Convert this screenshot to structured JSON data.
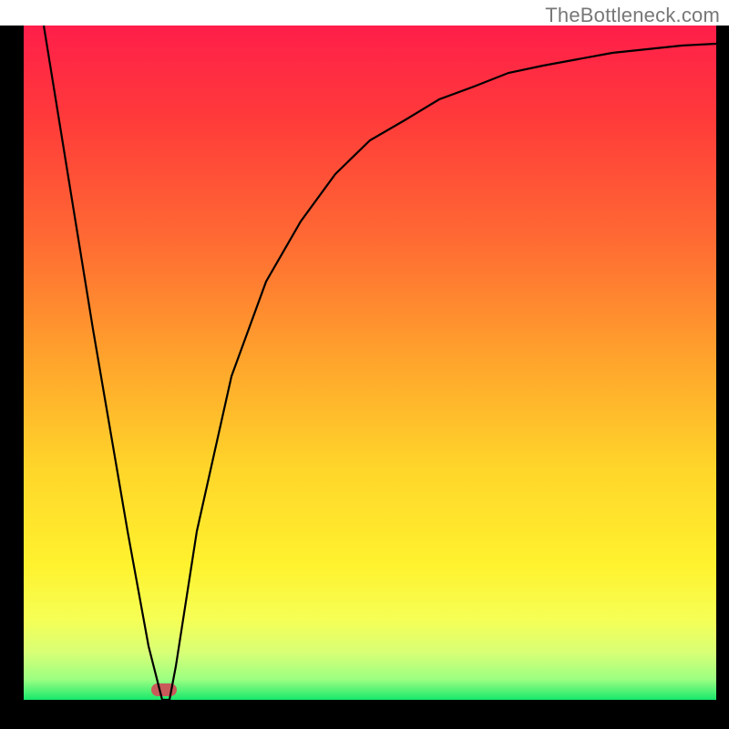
{
  "watermark": "TheBottleneck.com",
  "chart_data": {
    "type": "line",
    "title": "",
    "xlabel": "",
    "ylabel": "",
    "xlim": [
      0,
      100
    ],
    "ylim": [
      0,
      100
    ],
    "grid": false,
    "series": [
      {
        "name": "curve",
        "x": [
          3,
          10,
          15,
          18,
          20,
          21,
          22,
          25,
          30,
          35,
          40,
          45,
          50,
          55,
          60,
          65,
          70,
          75,
          80,
          85,
          90,
          95,
          100
        ],
        "y": [
          100,
          55,
          25,
          8,
          0,
          0,
          5,
          25,
          48,
          62,
          71,
          78,
          83,
          86,
          89,
          91,
          93,
          94,
          95,
          96,
          96.5,
          97,
          97.3
        ]
      }
    ],
    "marker": {
      "x": 20.5,
      "y": 0
    }
  },
  "colors": {
    "curve": "#000000",
    "marker": "#c95a5a",
    "gradient_top": "#ff1e4a",
    "gradient_bottom": "#17e86b"
  }
}
